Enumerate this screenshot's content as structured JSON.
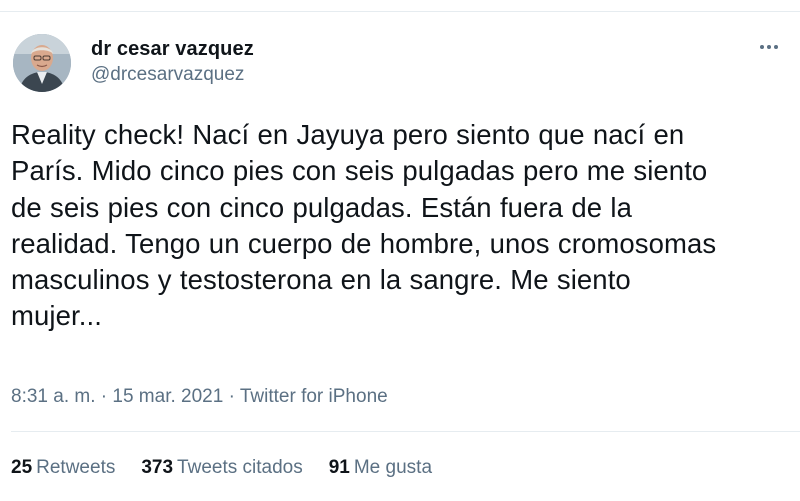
{
  "author": {
    "display_name": "dr cesar vazquez",
    "handle": "@drcesarvazquez"
  },
  "tweet": {
    "text": "Reality check! Nací en Jayuya pero siento que nací en París. Mido cinco pies con seis pulgadas pero me siento de seis pies con cinco pulgadas. Están fuera de la realidad. Tengo un cuerpo de hombre, unos cromosomas masculinos y testosterona en la sangre. Me siento mujer...",
    "lines": [
      "Reality check! Nací en Jayuya pero siento que nací en",
      "París. Mido cinco pies con seis pulgadas pero me siento",
      "de seis pies con cinco pulgadas. Están fuera de la",
      "realidad. Tengo un cuerpo de hombre, unos cromosomas",
      "masculinos y testosterona en la sangre. Me siento",
      "mujer..."
    ]
  },
  "meta": {
    "time": "8:31 a. m.",
    "separator": " · ",
    "date": "15 mar. 2021",
    "source": "Twitter for iPhone"
  },
  "stats": {
    "retweets": {
      "count": "25",
      "label": "Retweets"
    },
    "quotes": {
      "count": "373",
      "label": "Tweets citados"
    },
    "likes": {
      "count": "91",
      "label": "Me gusta"
    }
  },
  "icons": {
    "more": "more-horizontal-icon",
    "avatar": "avatar"
  },
  "colors": {
    "text": "#0f1419",
    "secondary": "#5b7083",
    "divider": "#e6ecf0"
  }
}
